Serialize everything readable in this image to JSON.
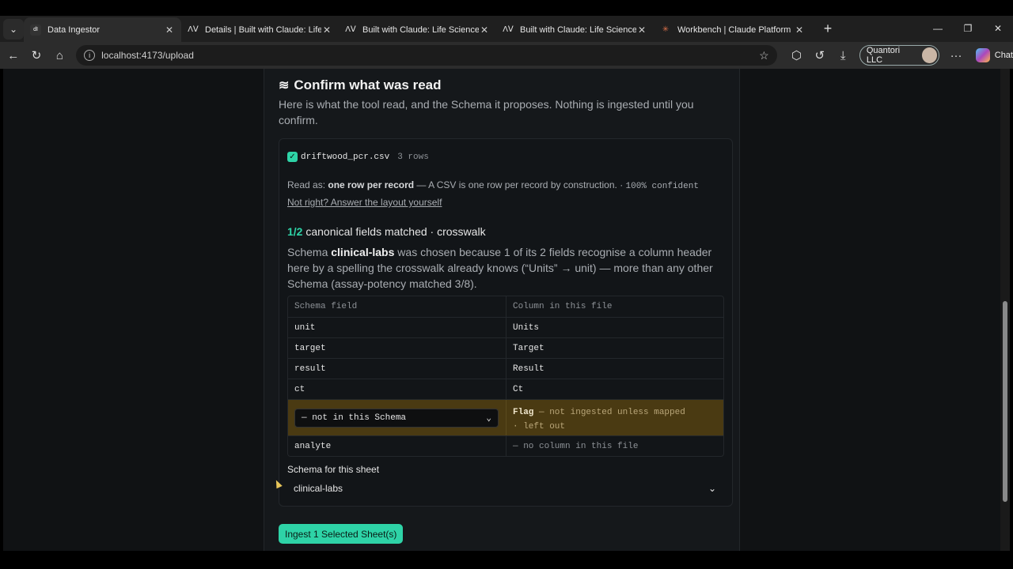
{
  "browser": {
    "tabs": [
      {
        "title": "Data Ingestor",
        "icon": "app-favicon",
        "active": true
      },
      {
        "title": "Details | Built with Claude: Life Scie",
        "icon": "anthropic-favicon"
      },
      {
        "title": "Built with Claude: Life Sciences",
        "icon": "anthropic-favicon"
      },
      {
        "title": "Built with Claude: Life Sciences",
        "icon": "anthropic-favicon"
      },
      {
        "title": "Workbench | Claude Platform",
        "icon": "claude-favicon"
      }
    ],
    "url": "localhost:4173/upload",
    "profile_name": "Quantori LLC",
    "chat_label": "Chat"
  },
  "page": {
    "title": "Confirm what was read",
    "subtitle": "Here is what the tool read, and the Schema it proposes. Nothing is ingested until you confirm.",
    "file": {
      "name": "driftwood_pcr.csv",
      "rows": "3 rows",
      "read_as_prefix": "Read as: ",
      "read_as_bold": "one row per record",
      "read_as_suffix": " — A CSV is one row per record by construction. · ",
      "confidence": "100% confident",
      "not_right_link": "Not right? Answer the layout yourself",
      "matched_fraction": "1/2",
      "matched_text": " canonical fields matched · crosswalk",
      "explain_prefix": "Schema ",
      "explain_schema": "clinical-labs",
      "explain_suffix": " was chosen because 1 of its 2 fields recognise a column header here by a spelling the crosswalk already knows (“Units” → unit) — more than any other Schema (assay-potency matched 3/8).",
      "table": {
        "headers": [
          "Schema field",
          "Column in this file"
        ],
        "rows": [
          {
            "field": "unit",
            "column": "Units"
          },
          {
            "field": "target",
            "column": "Target"
          },
          {
            "field": "result",
            "column": "Result"
          },
          {
            "field": "ct",
            "column": "Ct"
          }
        ],
        "flag_row": {
          "select_value": "— not in this Schema",
          "column": "Flag",
          "note1": " — not ingested unless mapped",
          "note2": "· left out"
        },
        "last_row": {
          "field": "analyte",
          "column": "— no column in this file"
        }
      },
      "schema_label": "Schema for this sheet",
      "schema_value": "clinical-labs"
    },
    "ingest_button": "Ingest 1 Selected Sheet(s)"
  }
}
